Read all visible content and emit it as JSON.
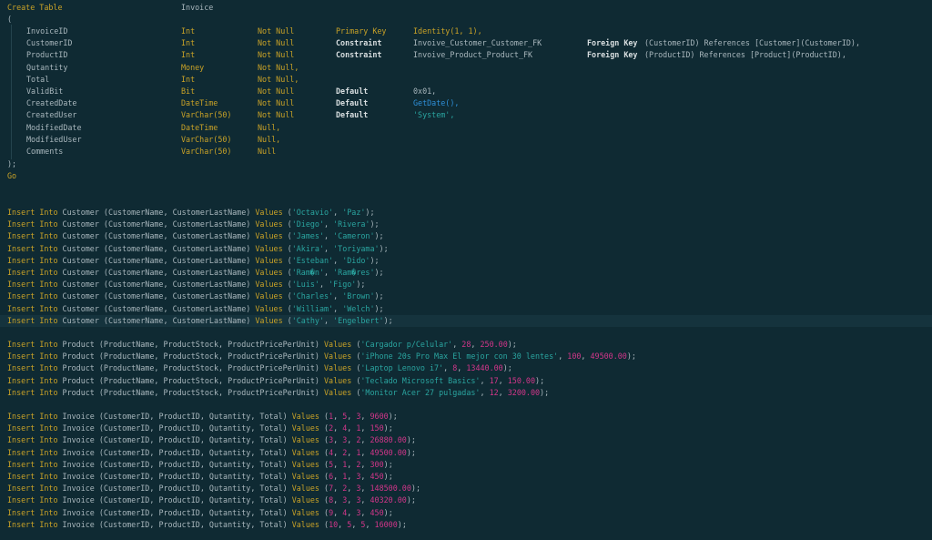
{
  "theme": {
    "background": "#0f2a33",
    "current_line": "#15333d",
    "keyword": "#c9a227",
    "string": "#2aa5a0",
    "number": "#d3368a",
    "function": "#2e8fd8",
    "identifier": "#a9b7bd",
    "emphasis": "#d8dee0"
  },
  "create_table": {
    "keyword": "Create Table",
    "table_name": "Invoice",
    "open_paren": "(",
    "close_paren": ");",
    "go": "Go",
    "columns": [
      {
        "name": "InvoiceID",
        "type": "Int",
        "nullability": "Not Null",
        "c1": "Primary Key",
        "c2": "Identity(1, 1),",
        "fk": "",
        "fk_rest": ""
      },
      {
        "name": "CustomerID",
        "type": "Int",
        "nullability": "Not Null",
        "c1": "Constraint",
        "c2": "Invoive_Customer_Customer_FK",
        "fk": "Foreign Key",
        "fk_rest": "(CustomerID) References [Customer](CustomerID),"
      },
      {
        "name": "ProductID",
        "type": "Int",
        "nullability": "Not Null",
        "c1": "Constraint",
        "c2": "Invoive_Product_Product_FK",
        "fk": "Foreign Key",
        "fk_rest": "(ProductID) References [Product](ProductID),"
      },
      {
        "name": "Qutantity",
        "type": "Money",
        "nullability": "Not Null,",
        "c1": "",
        "c2": "",
        "fk": "",
        "fk_rest": ""
      },
      {
        "name": "Total",
        "type": "Int",
        "nullability": "Not Null,",
        "c1": "",
        "c2": "",
        "fk": "",
        "fk_rest": ""
      },
      {
        "name": "ValidBit",
        "type": "Bit",
        "nullability": "Not Null",
        "c1": "Default",
        "c2": "0x01,",
        "fk": "",
        "fk_rest": ""
      },
      {
        "name": "CreatedDate",
        "type": "DateTime",
        "nullability": "Not Null",
        "c1": "Default",
        "c2": "GetDate(),",
        "fk": "",
        "fk_rest": ""
      },
      {
        "name": "CreatedUser",
        "type": "VarChar(50)",
        "nullability": "Not Null",
        "c1": "Default",
        "c2": "'System',",
        "fk": "",
        "fk_rest": ""
      },
      {
        "name": "ModifiedDate",
        "type": "DateTime",
        "nullability": "Null,",
        "c1": "",
        "c2": "",
        "fk": "",
        "fk_rest": ""
      },
      {
        "name": "ModifiedUser",
        "type": "VarChar(50)",
        "nullability": "Null,",
        "c1": "",
        "c2": "",
        "fk": "",
        "fk_rest": ""
      },
      {
        "name": "Comments",
        "type": "VarChar(50)",
        "nullability": "Null",
        "c1": "",
        "c2": "",
        "fk": "",
        "fk_rest": ""
      }
    ]
  },
  "customer_inserts": [
    "Insert Into Customer (CustomerName, CustomerLastName) Values ('Octavio', 'Paz');",
    "Insert Into Customer (CustomerName, CustomerLastName) Values ('Diego', 'Rivera');",
    "Insert Into Customer (CustomerName, CustomerLastName) Values ('James', 'Cameron');",
    "Insert Into Customer (CustomerName, CustomerLastName) Values ('Akira', 'Toriyama');",
    "Insert Into Customer (CustomerName, CustomerLastName) Values ('Esteban', 'Dido');",
    "Insert Into Customer (CustomerName, CustomerLastName) Values ('Ram�n', 'Ram�res');",
    "Insert Into Customer (CustomerName, CustomerLastName) Values ('Luis', 'Figo');",
    "Insert Into Customer (CustomerName, CustomerLastName) Values ('Charles', 'Brown');",
    "Insert Into Customer (CustomerName, CustomerLastName) Values ('William', 'Welch');",
    "Insert Into Customer (CustomerName, CustomerLastName) Values ('Cathy', 'Engelbert');"
  ],
  "product_inserts": [
    "Insert Into Product (ProductName, ProductStock, ProductPricePerUnit) Values ('Cargador p/Celular', 28, 250.00);",
    "Insert Into Product (ProductName, ProductStock, ProductPricePerUnit) Values ('iPhone 20s Pro Max El mejor con 30 lentes', 100, 49500.00);",
    "Insert Into Product (ProductName, ProductStock, ProductPricePerUnit) Values ('Laptop Lenovo i7', 8, 13440.00);",
    "Insert Into Product (ProductName, ProductStock, ProductPricePerUnit) Values ('Teclado Microsoft Basics', 17, 150.00);",
    "Insert Into Product (ProductName, ProductStock, ProductPricePerUnit) Values ('Monitor Acer 27 pulgadas', 12, 3200.00);"
  ],
  "invoice_inserts": [
    "Insert Into Invoice (CustomerID, ProductID, Qutantity, Total) Values (1, 5, 3, 9600);",
    "Insert Into Invoice (CustomerID, ProductID, Qutantity, Total) Values (2, 4, 1, 150);",
    "Insert Into Invoice (CustomerID, ProductID, Qutantity, Total) Values (3, 3, 2, 26880.00);",
    "Insert Into Invoice (CustomerID, ProductID, Qutantity, Total) Values (4, 2, 1, 49500.00);",
    "Insert Into Invoice (CustomerID, ProductID, Qutantity, Total) Values (5, 1, 2, 300);",
    "Insert Into Invoice (CustomerID, ProductID, Qutantity, Total) Values (6, 1, 3, 450);",
    "Insert Into Invoice (CustomerID, ProductID, Qutantity, Total) Values (7, 2, 3, 148500.00);",
    "Insert Into Invoice (CustomerID, ProductID, Qutantity, Total) Values (8, 3, 3, 40320.00);",
    "Insert Into Invoice (CustomerID, ProductID, Qutantity, Total) Values (9, 4, 3, 450);",
    "Insert Into Invoice (CustomerID, ProductID, Qutantity, Total) Values (10, 5, 5, 16000);"
  ],
  "current_line": "customer_inserts.9"
}
